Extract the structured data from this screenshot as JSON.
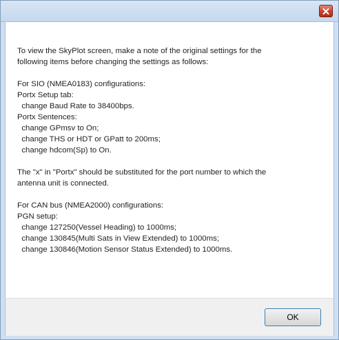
{
  "title_bar": {
    "close_icon": "close-x-icon",
    "close_color": "#c6402a"
  },
  "message": {
    "blocks": [
      [
        "To view the SkyPlot screen, make a note of the original settings for the",
        "following items before changing the settings as follows:"
      ],
      [
        "For SIO (NMEA0183) configurations:",
        "Portx Setup tab:",
        "  change Baud Rate to 38400bps.",
        "Portx Sentences:",
        "  change GPmsv to On;",
        "  change THS or HDT or GPatt to 200ms;",
        "  change hdcom(Sp) to On."
      ],
      [
        "The \"x\" in \"Portx\" should be substituted for the port number to which the",
        "antenna unit is connected."
      ],
      [
        "For CAN bus (NMEA2000) configurations:",
        "PGN setup:",
        "  change 127250(Vessel Heading) to 1000ms;",
        "  change 130845(Multi Sats in View Extended) to 1000ms;",
        "  change 130846(Motion Sensor Status Extended) to 1000ms."
      ]
    ]
  },
  "footer": {
    "ok_label": "OK"
  }
}
